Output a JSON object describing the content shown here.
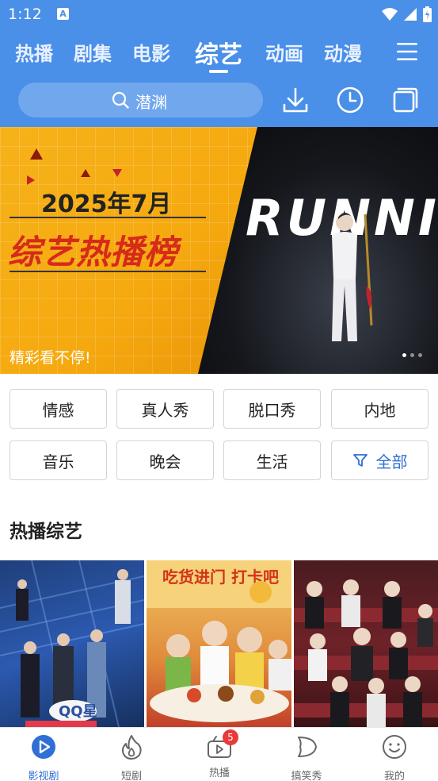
{
  "status_bar": {
    "time": "1:12",
    "a_badge": "A"
  },
  "tabs": [
    {
      "label": "热播"
    },
    {
      "label": "剧集"
    },
    {
      "label": "电影"
    },
    {
      "label": "综艺",
      "active": true
    },
    {
      "label": "动画"
    },
    {
      "label": "动漫"
    }
  ],
  "search": {
    "placeholder": "潜渊"
  },
  "banner": {
    "date": "2025年7月",
    "title": "综艺热播榜",
    "stage_text": "RUNNIN",
    "caption": "精彩看不停!",
    "page_count": 3,
    "current_page": 1
  },
  "categories": [
    {
      "label": "情感"
    },
    {
      "label": "真人秀"
    },
    {
      "label": "脱口秀"
    },
    {
      "label": "内地"
    },
    {
      "label": "音乐"
    },
    {
      "label": "晚会"
    },
    {
      "label": "生活"
    },
    {
      "label": "全部",
      "icon": "filter-icon"
    }
  ],
  "section": {
    "title": "热播综艺"
  },
  "posters": [
    {
      "logo_text": "QQ星"
    },
    {
      "logo_text": "吃货进门 打卡吧"
    },
    {
      "logo_text": ""
    }
  ],
  "bottom_nav": [
    {
      "label": "影视剧",
      "icon": "play-icon",
      "active": true
    },
    {
      "label": "短剧",
      "icon": "flame-icon"
    },
    {
      "label": "热播",
      "icon": "video-camera-icon",
      "badge": "5"
    },
    {
      "label": "搞笑秀",
      "icon": "speech-bubble-icon"
    },
    {
      "label": "我的",
      "icon": "smiley-icon"
    }
  ],
  "colors": {
    "header_blue": "#4a8fe8",
    "accent_blue": "#2f6fd6",
    "banner_orange": "#f7b21a",
    "banner_red": "#d62a1a",
    "badge_red": "#e83a3a"
  }
}
